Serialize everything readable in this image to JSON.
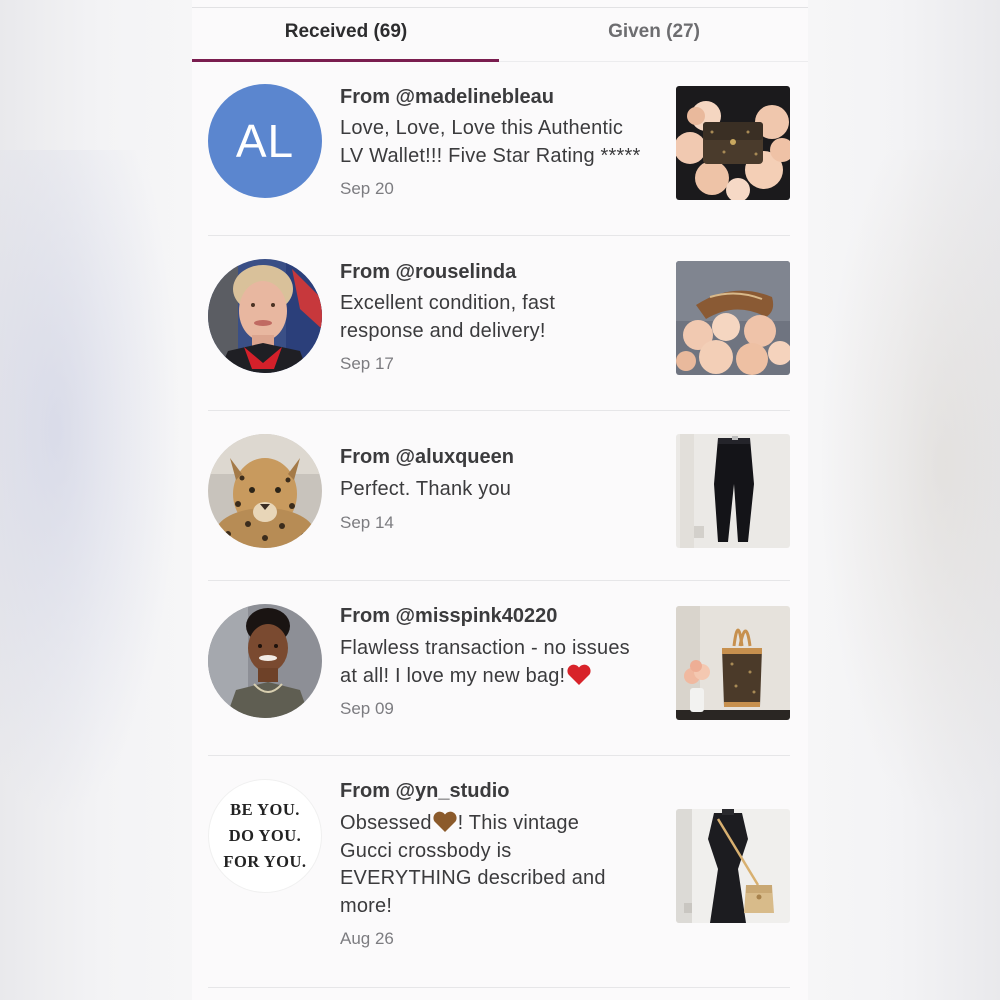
{
  "tabs": {
    "received": "Received (69)",
    "given": "Given (27)"
  },
  "reviews": [
    {
      "from": "From @madelinebleau",
      "initials": "AL",
      "comment_line1": "Love, Love, Love this Authentic",
      "comment_line2": "LV Wallet!!! Five Star Rating *****",
      "date": "Sep 20"
    },
    {
      "from": "From @rouselinda",
      "comment_line1": "Excellent condition, fast",
      "comment_line2": "response and delivery!",
      "date": "Sep 17"
    },
    {
      "from": "From @aluxqueen",
      "comment_line1": "Perfect. Thank you",
      "date": "Sep 14"
    },
    {
      "from": "From @misspink40220",
      "comment_line1": "Flawless transaction - no issues",
      "comment_line2": "at all! I love my new bag!",
      "date": "Sep 09"
    },
    {
      "from": "From @yn_studio",
      "avatar_text": [
        "BE YOU.",
        "DO YOU.",
        "FOR YOU."
      ],
      "comment_line1_a": "Obsessed",
      "comment_line1_b": "! This vintage",
      "comment_line2": "Gucci crossbody is",
      "comment_line3": "EVERYTHING described and",
      "comment_line4": "more!",
      "date": "Aug 26"
    }
  ],
  "colors": {
    "accent": "#7a1d4f",
    "avatar_blue": "#5b86cf",
    "text": "#3b3b3d",
    "muted": "#7c7c80"
  }
}
